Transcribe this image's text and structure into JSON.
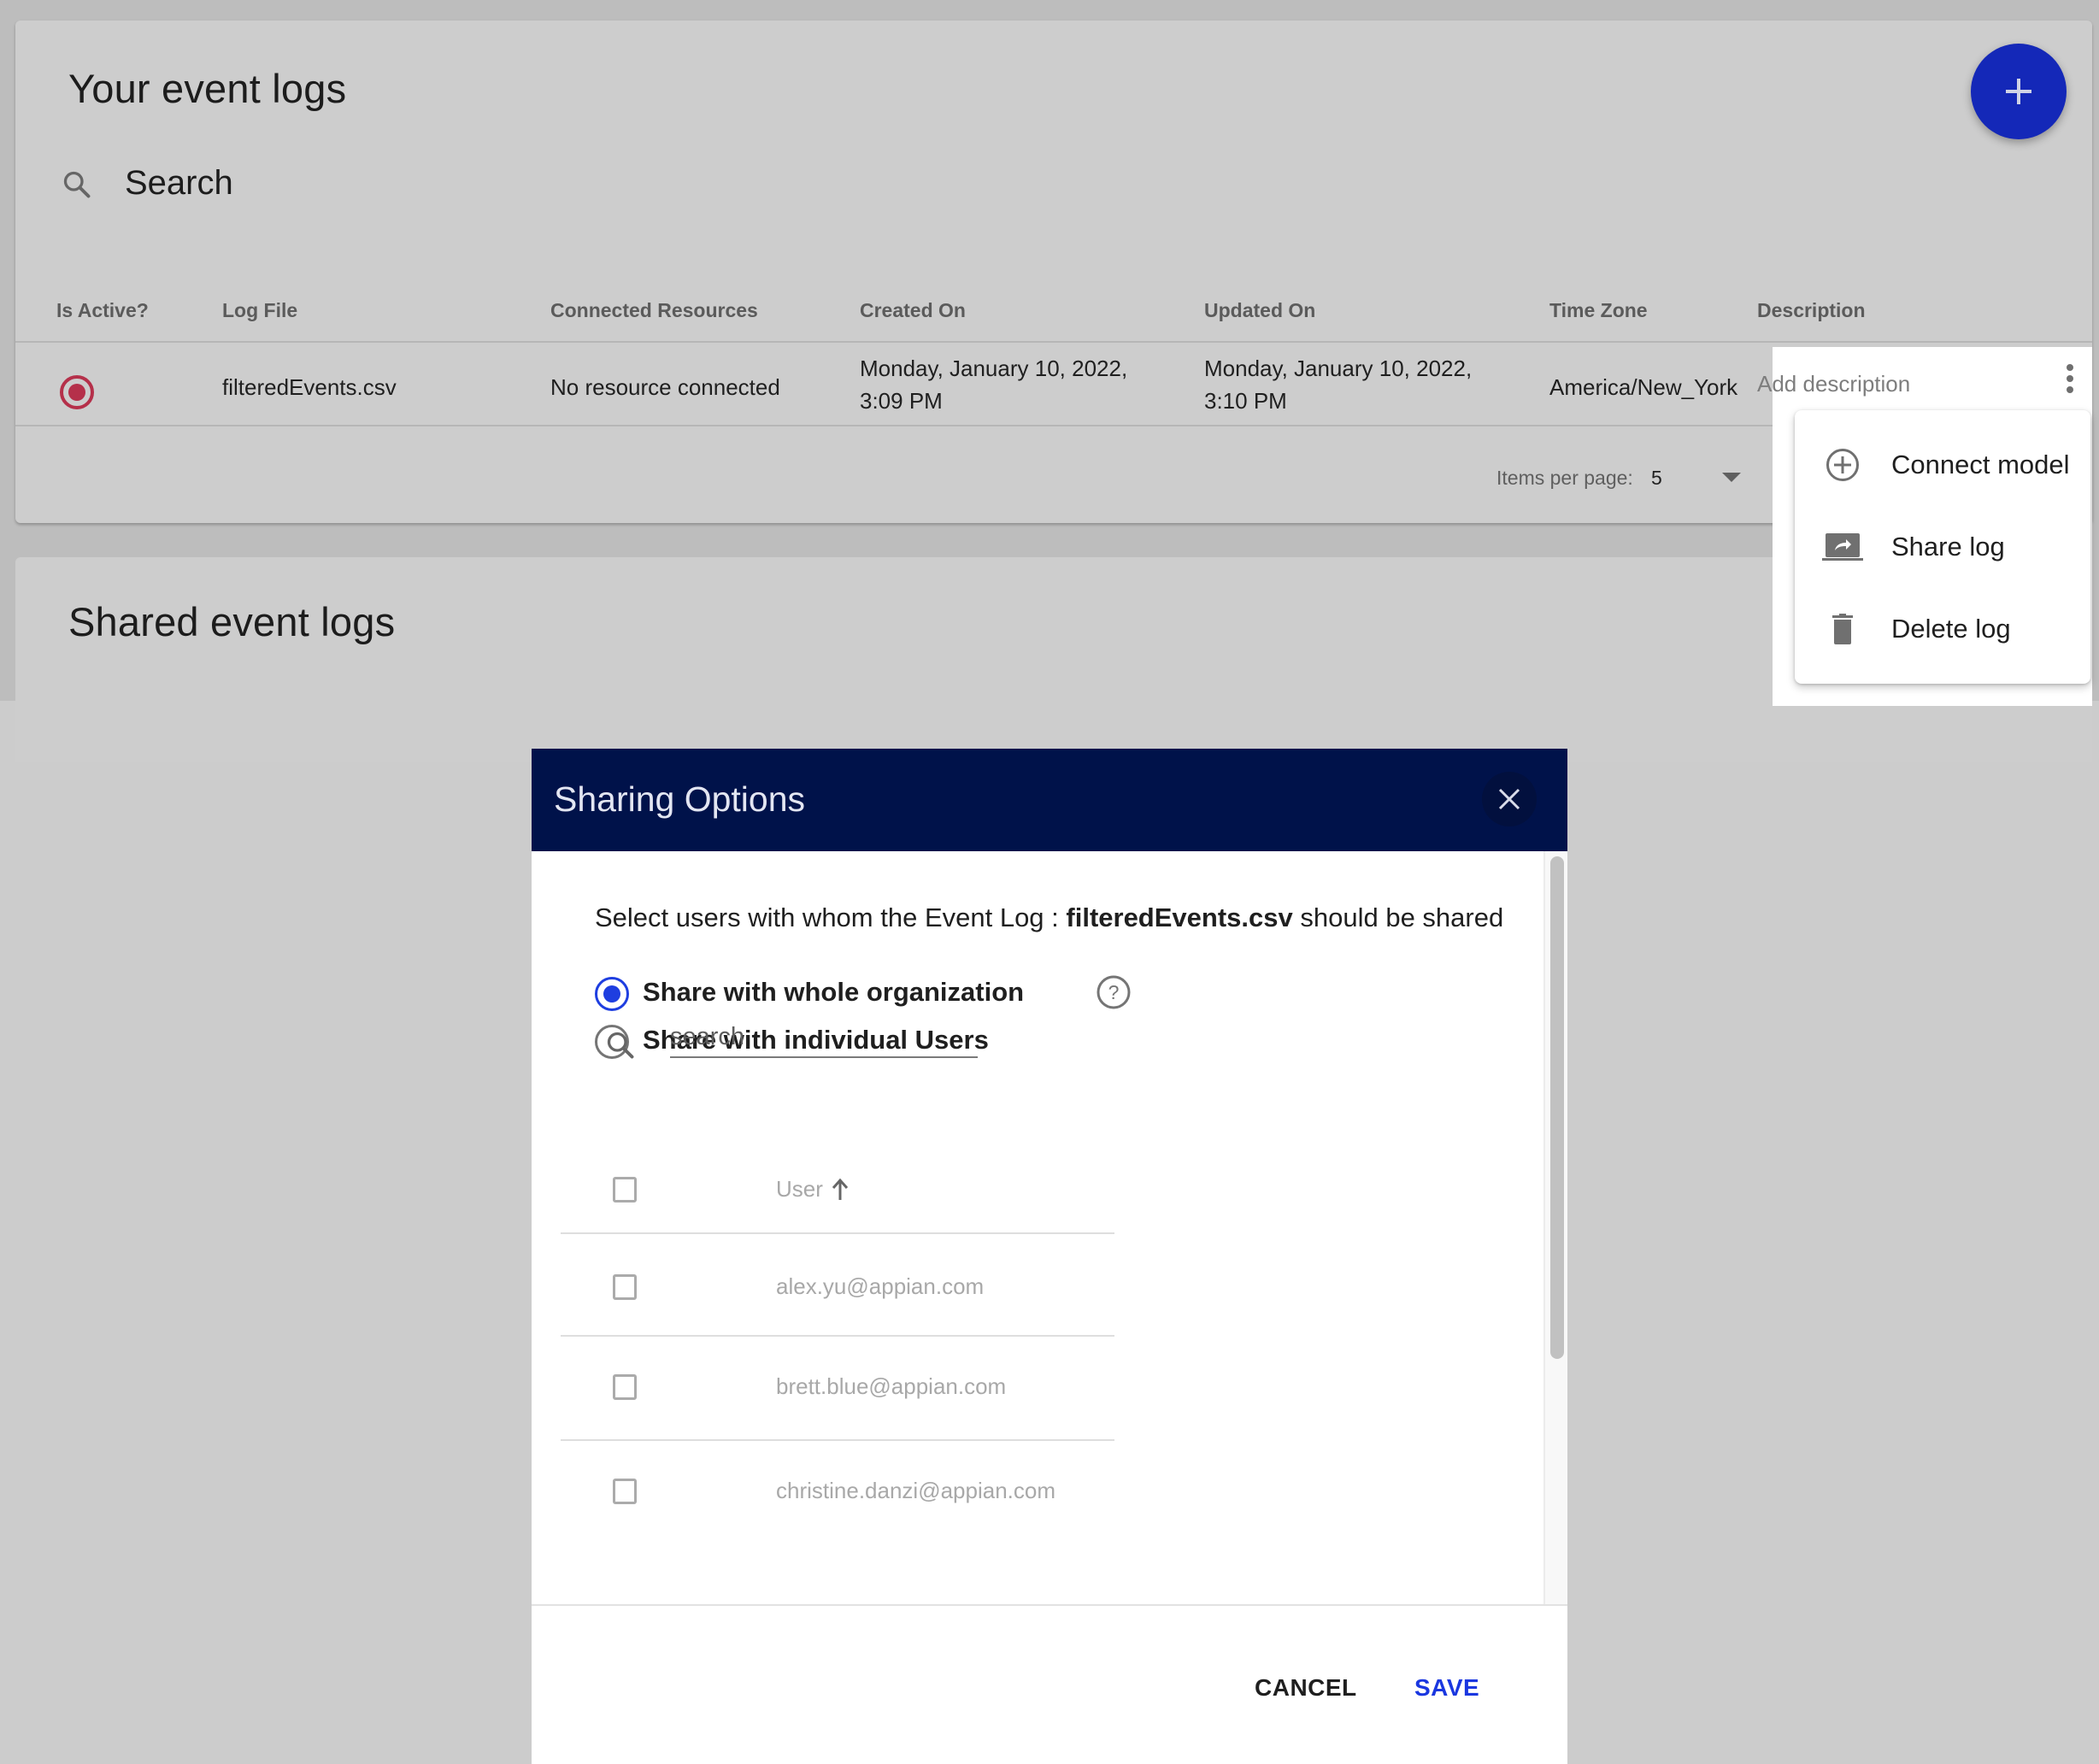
{
  "your_logs": {
    "title": "Your event logs",
    "search_label": "Search",
    "add_button_icon": "plus-icon",
    "table": {
      "columns": [
        "Is Active?",
        "Log File",
        "Connected Resources",
        "Created On",
        "Updated On",
        "Time Zone",
        "Description"
      ],
      "rows": [
        {
          "is_active_icon": "radio-checked-icon",
          "log_file": "filteredEvents.csv",
          "connected_resources": "No resource connected",
          "created_on_line1": "Monday, January 10, 2022,",
          "created_on_line2": "3:09 PM",
          "updated_on_line1": "Monday, January 10, 2022,",
          "updated_on_line2": "3:10 PM",
          "time_zone": "America/New_York",
          "description_placeholder": "Add description",
          "actions_icon": "more-vert-icon"
        }
      ]
    },
    "pagination": {
      "items_per_page_label": "Items per page:",
      "items_per_page_value": "5"
    }
  },
  "row_menu": {
    "items": [
      {
        "label": "Connect model",
        "icon": "add-circle-icon"
      },
      {
        "label": "Share log",
        "icon": "share-screen-icon"
      },
      {
        "label": "Delete log",
        "icon": "trash-icon"
      }
    ]
  },
  "shared_logs": {
    "title": "Shared event logs"
  },
  "dialog": {
    "title": "Sharing Options",
    "prompt_prefix": "Select users with whom the Event Log : ",
    "prompt_file": "filteredEvents.csv",
    "prompt_suffix": " should be shared",
    "options": [
      {
        "label": "Share with whole organization",
        "checked": true
      },
      {
        "label": "Share with individual Users",
        "checked": false
      }
    ],
    "search_placeholder": "search",
    "search_value": "",
    "user_column": "User",
    "sort_direction": "ascending",
    "users": [
      "alex.yu@appian.com",
      "brett.blue@appian.com",
      "christine.danzi@appian.com"
    ],
    "cancel_label": "CANCEL",
    "save_label": "SAVE"
  },
  "colors": {
    "accent_blue": "#1428b8",
    "dialog_header": "#00124a",
    "radio_selected": "#1e3ee0",
    "save_text": "#1a37e0",
    "active_indicator": "#b5304a"
  }
}
